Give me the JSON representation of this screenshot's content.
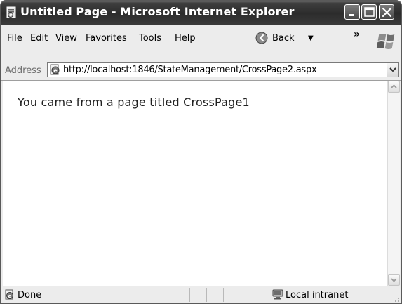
{
  "window": {
    "title": "Untitled Page - Microsoft Internet Explorer",
    "controls": [
      "minimize",
      "maximize",
      "close"
    ]
  },
  "menubar": {
    "items": [
      {
        "label": "File"
      },
      {
        "label": "Edit"
      },
      {
        "label": "View"
      },
      {
        "label": "Favorites"
      },
      {
        "label": "Tools"
      },
      {
        "label": "Help"
      }
    ],
    "back_label": "Back",
    "overflow_label": "»"
  },
  "addressbar": {
    "label": "Address",
    "url": "http://localhost:1846/StateManagement/CrossPage2.aspx"
  },
  "content": {
    "message": "You came from a page titled CrossPage1"
  },
  "statusbar": {
    "status": "Done",
    "zone": "Local intranet"
  },
  "icons": {
    "app": "ie-page-icon",
    "back": "back-arrow-icon",
    "logo": "windows-logo-icon",
    "page": "page-icon",
    "zone": "local-intranet-icon"
  },
  "colors": {
    "titlebar": "#2c2c2c",
    "title_text": "#ffffff",
    "chrome": "#ececec",
    "content_bg": "#ffffff"
  }
}
